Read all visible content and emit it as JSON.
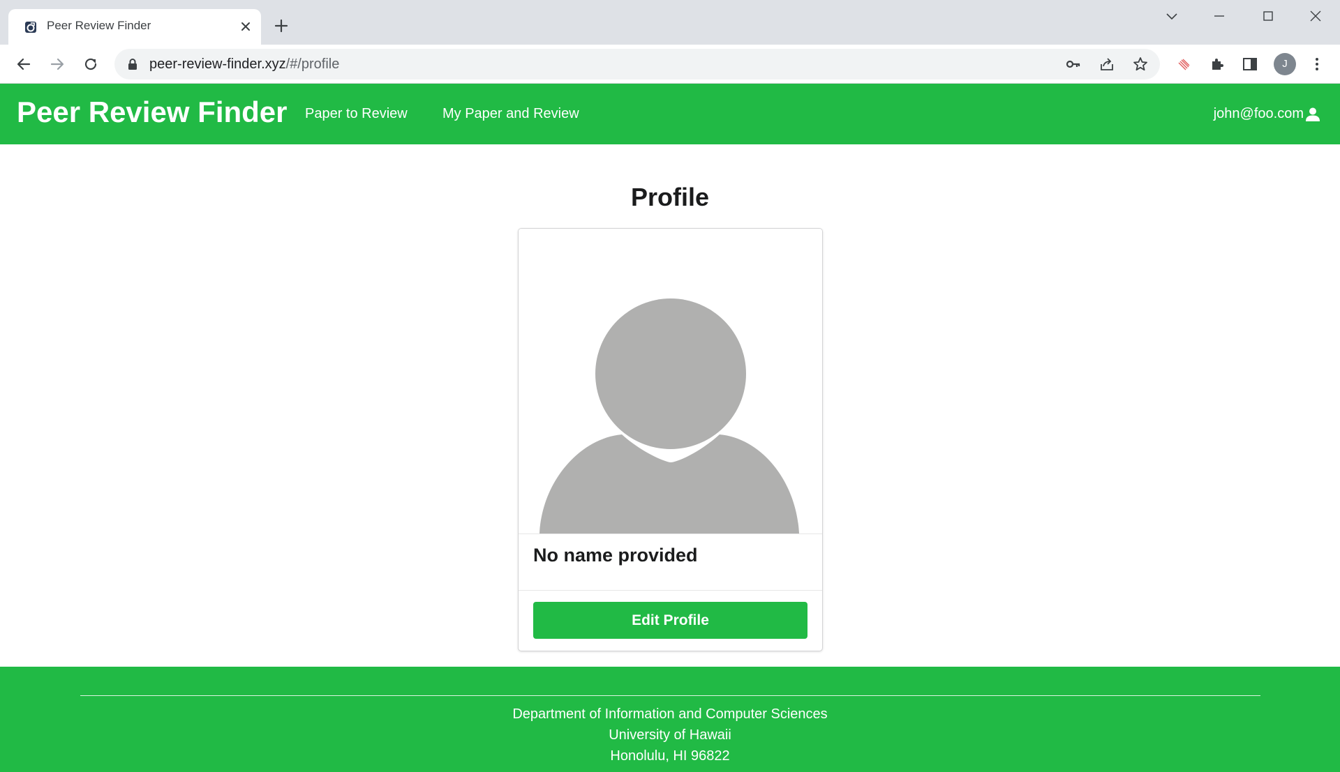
{
  "browser": {
    "tab_title": "Peer Review Finder",
    "url_host": "peer-review-finder.xyz",
    "url_path": "/#/profile",
    "profile_initial": "J"
  },
  "navbar": {
    "brand": "Peer Review Finder",
    "links": [
      "Paper to Review",
      "My Paper and Review"
    ],
    "user_email": "john@foo.com"
  },
  "main": {
    "title": "Profile",
    "card": {
      "name": "No name provided",
      "edit_button": "Edit Profile"
    }
  },
  "footer": {
    "lines": [
      "Department of Information and Computer Sciences",
      "University of Hawaii",
      "Honolulu, HI 96822"
    ]
  },
  "colors": {
    "brand_green": "#21ba45",
    "placeholder_gray": "#b0b0af"
  },
  "icons": [
    "favicon-icon",
    "close-icon",
    "plus-icon",
    "chevron-down-icon",
    "minimize-icon",
    "maximize-icon",
    "window-close-icon",
    "back-icon",
    "forward-icon",
    "reload-icon",
    "lock-icon",
    "key-icon",
    "share-icon",
    "star-icon",
    "extension-icon",
    "puzzle-icon",
    "side-panel-icon",
    "more-icon",
    "user-icon"
  ]
}
